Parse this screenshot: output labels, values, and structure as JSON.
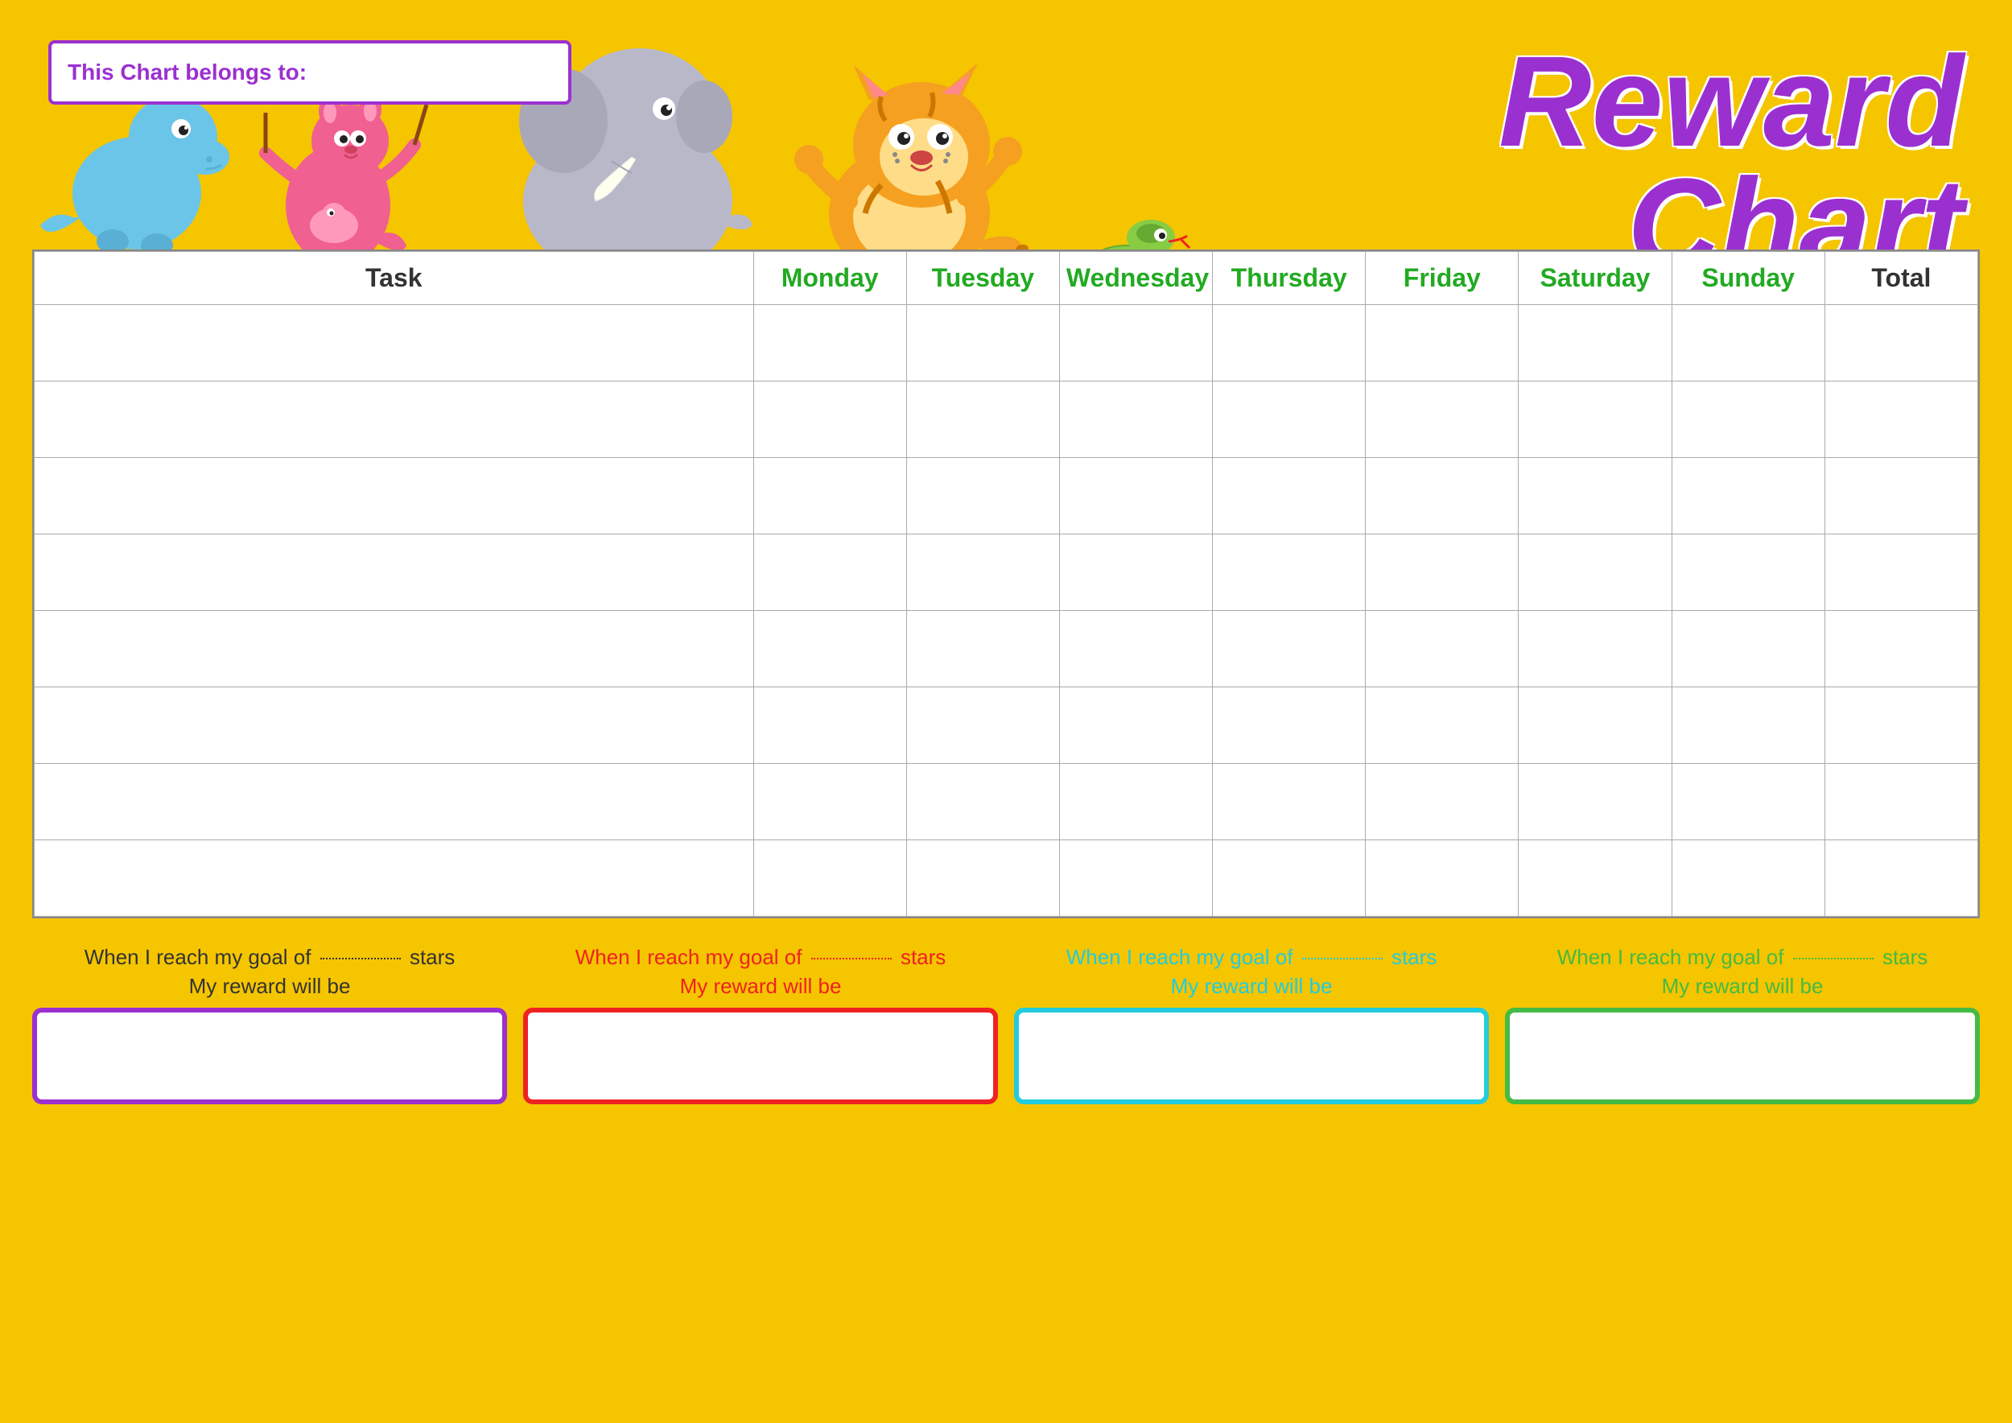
{
  "title": {
    "line1": "Reward",
    "line2": "Chart"
  },
  "belongs_to_label": "This Chart belongs to:",
  "columns": {
    "task": "Task",
    "monday": "Monday",
    "tuesday": "Tuesday",
    "wednesday": "Wednesday",
    "thursday": "Thursday",
    "friday": "Friday",
    "saturday": "Saturday",
    "sunday": "Sunday",
    "total": "Total"
  },
  "rows": 8,
  "footer": [
    {
      "id": "purple",
      "text_part1": "When I reach my goal of",
      "text_part2": "stars",
      "text_part3": "My reward will be",
      "color_class": "goal-purple",
      "box_class": "reward-box-purple"
    },
    {
      "id": "red",
      "text_part1": "When I reach my goal of",
      "text_part2": "stars",
      "text_part3": "My reward will be",
      "color_class": "goal-red",
      "box_class": "reward-box-red"
    },
    {
      "id": "cyan",
      "text_part1": "When I reach my goal of",
      "text_part2": "stars",
      "text_part3": "My reward will be",
      "color_class": "goal-cyan",
      "box_class": "reward-box-cyan"
    },
    {
      "id": "green",
      "text_part1": "When I reach my goal of",
      "text_part2": "stars",
      "text_part3": "My reward will be",
      "color_class": "goal-green",
      "box_class": "reward-box-green"
    }
  ],
  "colors": {
    "background": "#F5C500",
    "purple": "#9B30D0",
    "green": "#22AA22",
    "red": "#EE2222",
    "cyan": "#22CCDD",
    "dark_green": "#44BB44"
  }
}
